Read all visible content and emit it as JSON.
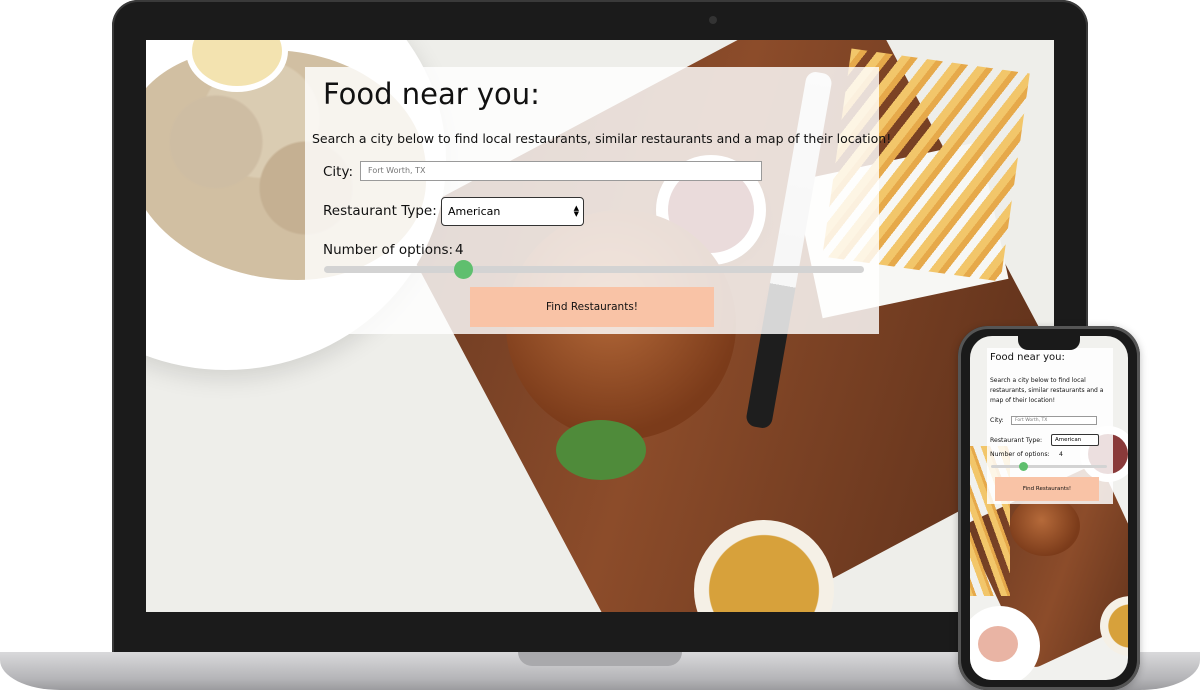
{
  "app": {
    "title": "Food near you:",
    "description": "Search a city below to find local restaurants, similar restaurants and a map of their location!",
    "city_label": "City:",
    "city_placeholder": "Fort Worth, TX",
    "type_label": "Restaurant Type:",
    "type_selected": "American",
    "options_label": "Number of options:",
    "options_value": "4",
    "options_fraction": 0.25,
    "find_button": "Find Restaurants!"
  },
  "colors": {
    "button_bg": "#f9c3a6",
    "slider_thumb": "#5fbf6e",
    "slider_track": "#d3d3d3"
  },
  "icons": {
    "select_arrows": "up-down-chevron-icon"
  }
}
